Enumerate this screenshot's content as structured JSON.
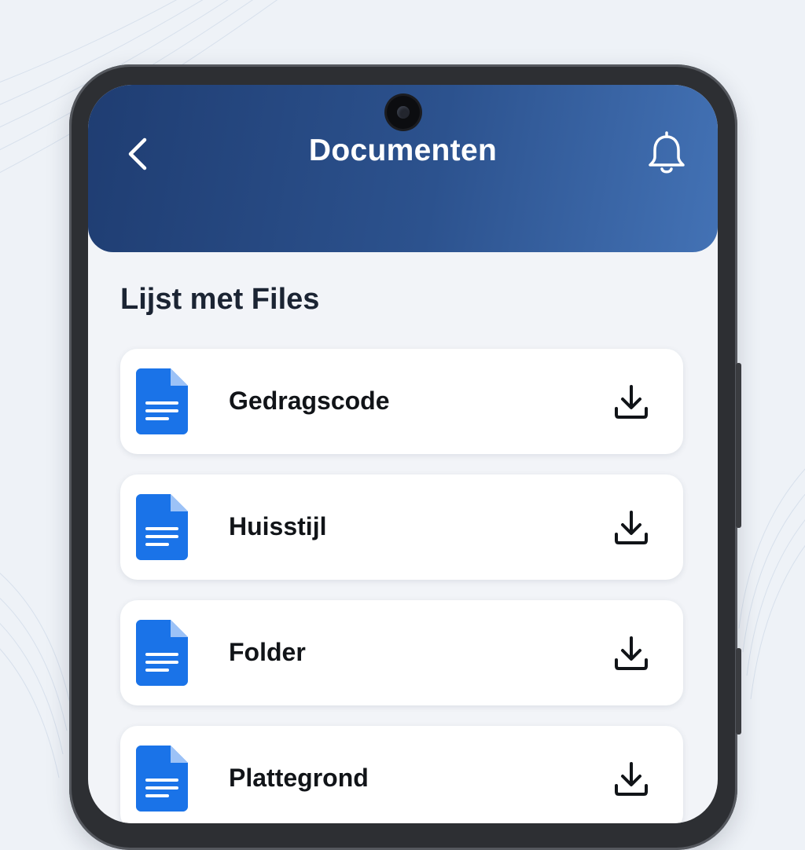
{
  "header": {
    "title": "Documenten",
    "back_icon": "chevron-left-icon",
    "notification_icon": "bell-icon"
  },
  "section": {
    "title": "Lijst met Files"
  },
  "files": [
    {
      "name": "Gedragscode",
      "icon": "document-icon",
      "action_icon": "download-icon"
    },
    {
      "name": "Huisstijl",
      "icon": "document-icon",
      "action_icon": "download-icon"
    },
    {
      "name": "Folder",
      "icon": "document-icon",
      "action_icon": "download-icon"
    },
    {
      "name": "Plattegrond",
      "icon": "document-icon",
      "action_icon": "download-icon"
    }
  ],
  "colors": {
    "header_start": "#1f3d72",
    "header_end": "#4372b5",
    "doc_icon": "#1a73e8",
    "background": "#f2f4f8"
  }
}
